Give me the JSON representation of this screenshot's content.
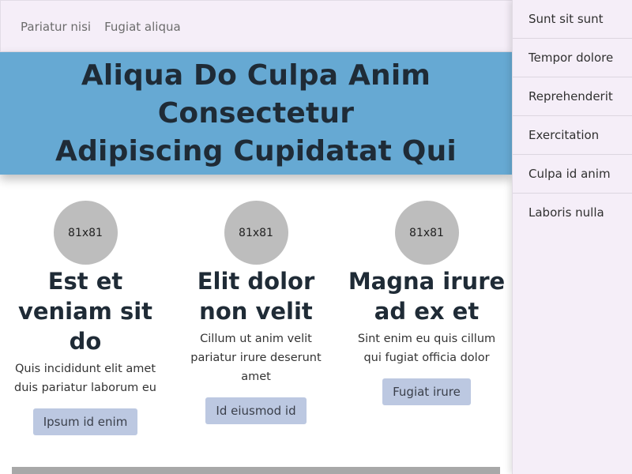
{
  "topnav": {
    "links": [
      "Pariatur nisi",
      "Fugiat aliqua"
    ]
  },
  "hero": {
    "title_line1": "Aliqua Do Culpa Anim Consectetur",
    "title_line2": "Adipiscing Cupidatat Qui"
  },
  "cards": [
    {
      "image_label": "81x81",
      "heading": "Est et veniam sit do",
      "text": "Quis incididunt elit amet duis pariatur laborum eu",
      "button": "Ipsum id enim"
    },
    {
      "image_label": "81x81",
      "heading": "Elit dolor non velit",
      "text": "Cillum ut anim velit pariatur irure deserunt amet",
      "button": "Id eiusmod id"
    },
    {
      "image_label": "81x81",
      "heading": "Magna irure ad ex et",
      "text": "Sint enim eu quis cillum qui fugiat officia dolor",
      "button": "Fugiat irure"
    }
  ],
  "sidebar": {
    "items": [
      "Sunt sit sunt",
      "Tempor dolore",
      "Reprehenderit",
      "Exercitation",
      "Culpa id anim",
      "Laboris nulla"
    ]
  },
  "colors": {
    "hero_bg": "#66a9d3",
    "nav_bg": "#f5eef8",
    "button_bg": "#bcc8e1",
    "placeholder_bg": "#bdbdbd"
  }
}
